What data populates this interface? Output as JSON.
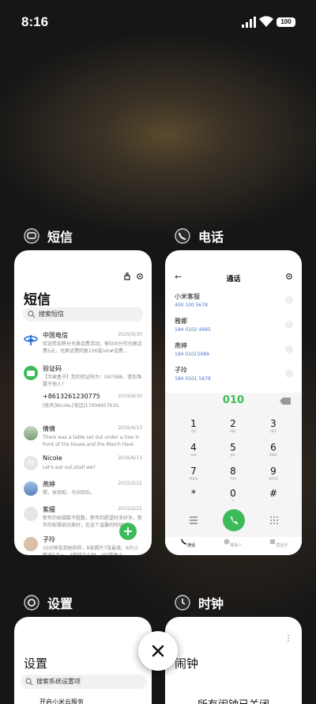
{
  "status": {
    "time": "8:16",
    "battery": "100"
  },
  "apps": [
    {
      "name": "短信",
      "icon": "sms-app-icon"
    },
    {
      "name": "电话",
      "icon": "phone-app-icon"
    },
    {
      "name": "设置",
      "icon": "settings-app-icon"
    },
    {
      "name": "时钟",
      "icon": "clock-app-icon"
    }
  ],
  "sms": {
    "title": "短信",
    "search": "搜索短信",
    "messages": [
      {
        "name": "中国电信",
        "date": "2025/9/30",
        "preview": "欢迎参加积分兑换话费活动，每500分可兑换话费5元，兑换话费回复106或/oh#话费..."
      },
      {
        "name": "验证码",
        "date": "",
        "preview": "【韦候盒子】您的验证码为：047588，请勿泄露于他人！"
      },
      {
        "name": "+8613261230775",
        "date": "2019/9/30",
        "preview": "[姓名]Nicole,[电话]17004957610,"
      },
      {
        "name": "倩倩",
        "date": "2016/6/13",
        "preview": "There was a table set out under a tree in front of the house,and the March Hare an..."
      },
      {
        "name": "Nicole",
        "date": "2016/6/13",
        "preview": "Let's eat out,shall we?"
      },
      {
        "name": "燕婷",
        "date": "2015/2/22",
        "preview": "嗯，收到啦，马乐回乐。"
      },
      {
        "name": "紫檀",
        "date": "2015/2/22",
        "preview": "新年的祝福数不胜数，新年的愿望好多好多，新年的祝福依旧美好，在这个温馨的时刻..."
      },
      {
        "name": "子玲",
        "date": "",
        "preview": "10分钟急到她的样，8张照片7张最美，6只小鸭子5点一，4朝四个小时，3只看她小..."
      }
    ],
    "fab": "+"
  },
  "phone": {
    "title": "通话",
    "back": "←",
    "contacts": [
      {
        "name": "小米客服",
        "number": "400 100 5678"
      },
      {
        "name": "雅娜",
        "number": "184 0102 4685"
      },
      {
        "name": "燕婷",
        "number": "184 01015689"
      },
      {
        "name": "子玲",
        "number": "184 0101 5678"
      }
    ],
    "dialed": "010",
    "keys": [
      {
        "d": "1",
        "l": "OO"
      },
      {
        "d": "2",
        "l": "ABC"
      },
      {
        "d": "3",
        "l": "DEF"
      },
      {
        "d": "4",
        "l": "GHI"
      },
      {
        "d": "5",
        "l": "JKL"
      },
      {
        "d": "6",
        "l": "MNO"
      },
      {
        "d": "7",
        "l": "PQRS"
      },
      {
        "d": "8",
        "l": "TUV"
      },
      {
        "d": "9",
        "l": "WXYZ"
      },
      {
        "d": "*",
        "l": ","
      },
      {
        "d": "0",
        "l": "+"
      },
      {
        "d": "#",
        "l": ""
      }
    ],
    "tabs": [
      "通话",
      "联系人",
      "营业厅"
    ]
  },
  "settings": {
    "title": "设置",
    "search": "搜索系统设置项",
    "item": "开启小米云服务"
  },
  "clock": {
    "title": "闹钟",
    "status": "所有闹钟已关闭"
  },
  "colors": {
    "accent": "#3dbb5a",
    "number": "#4a78c6"
  }
}
